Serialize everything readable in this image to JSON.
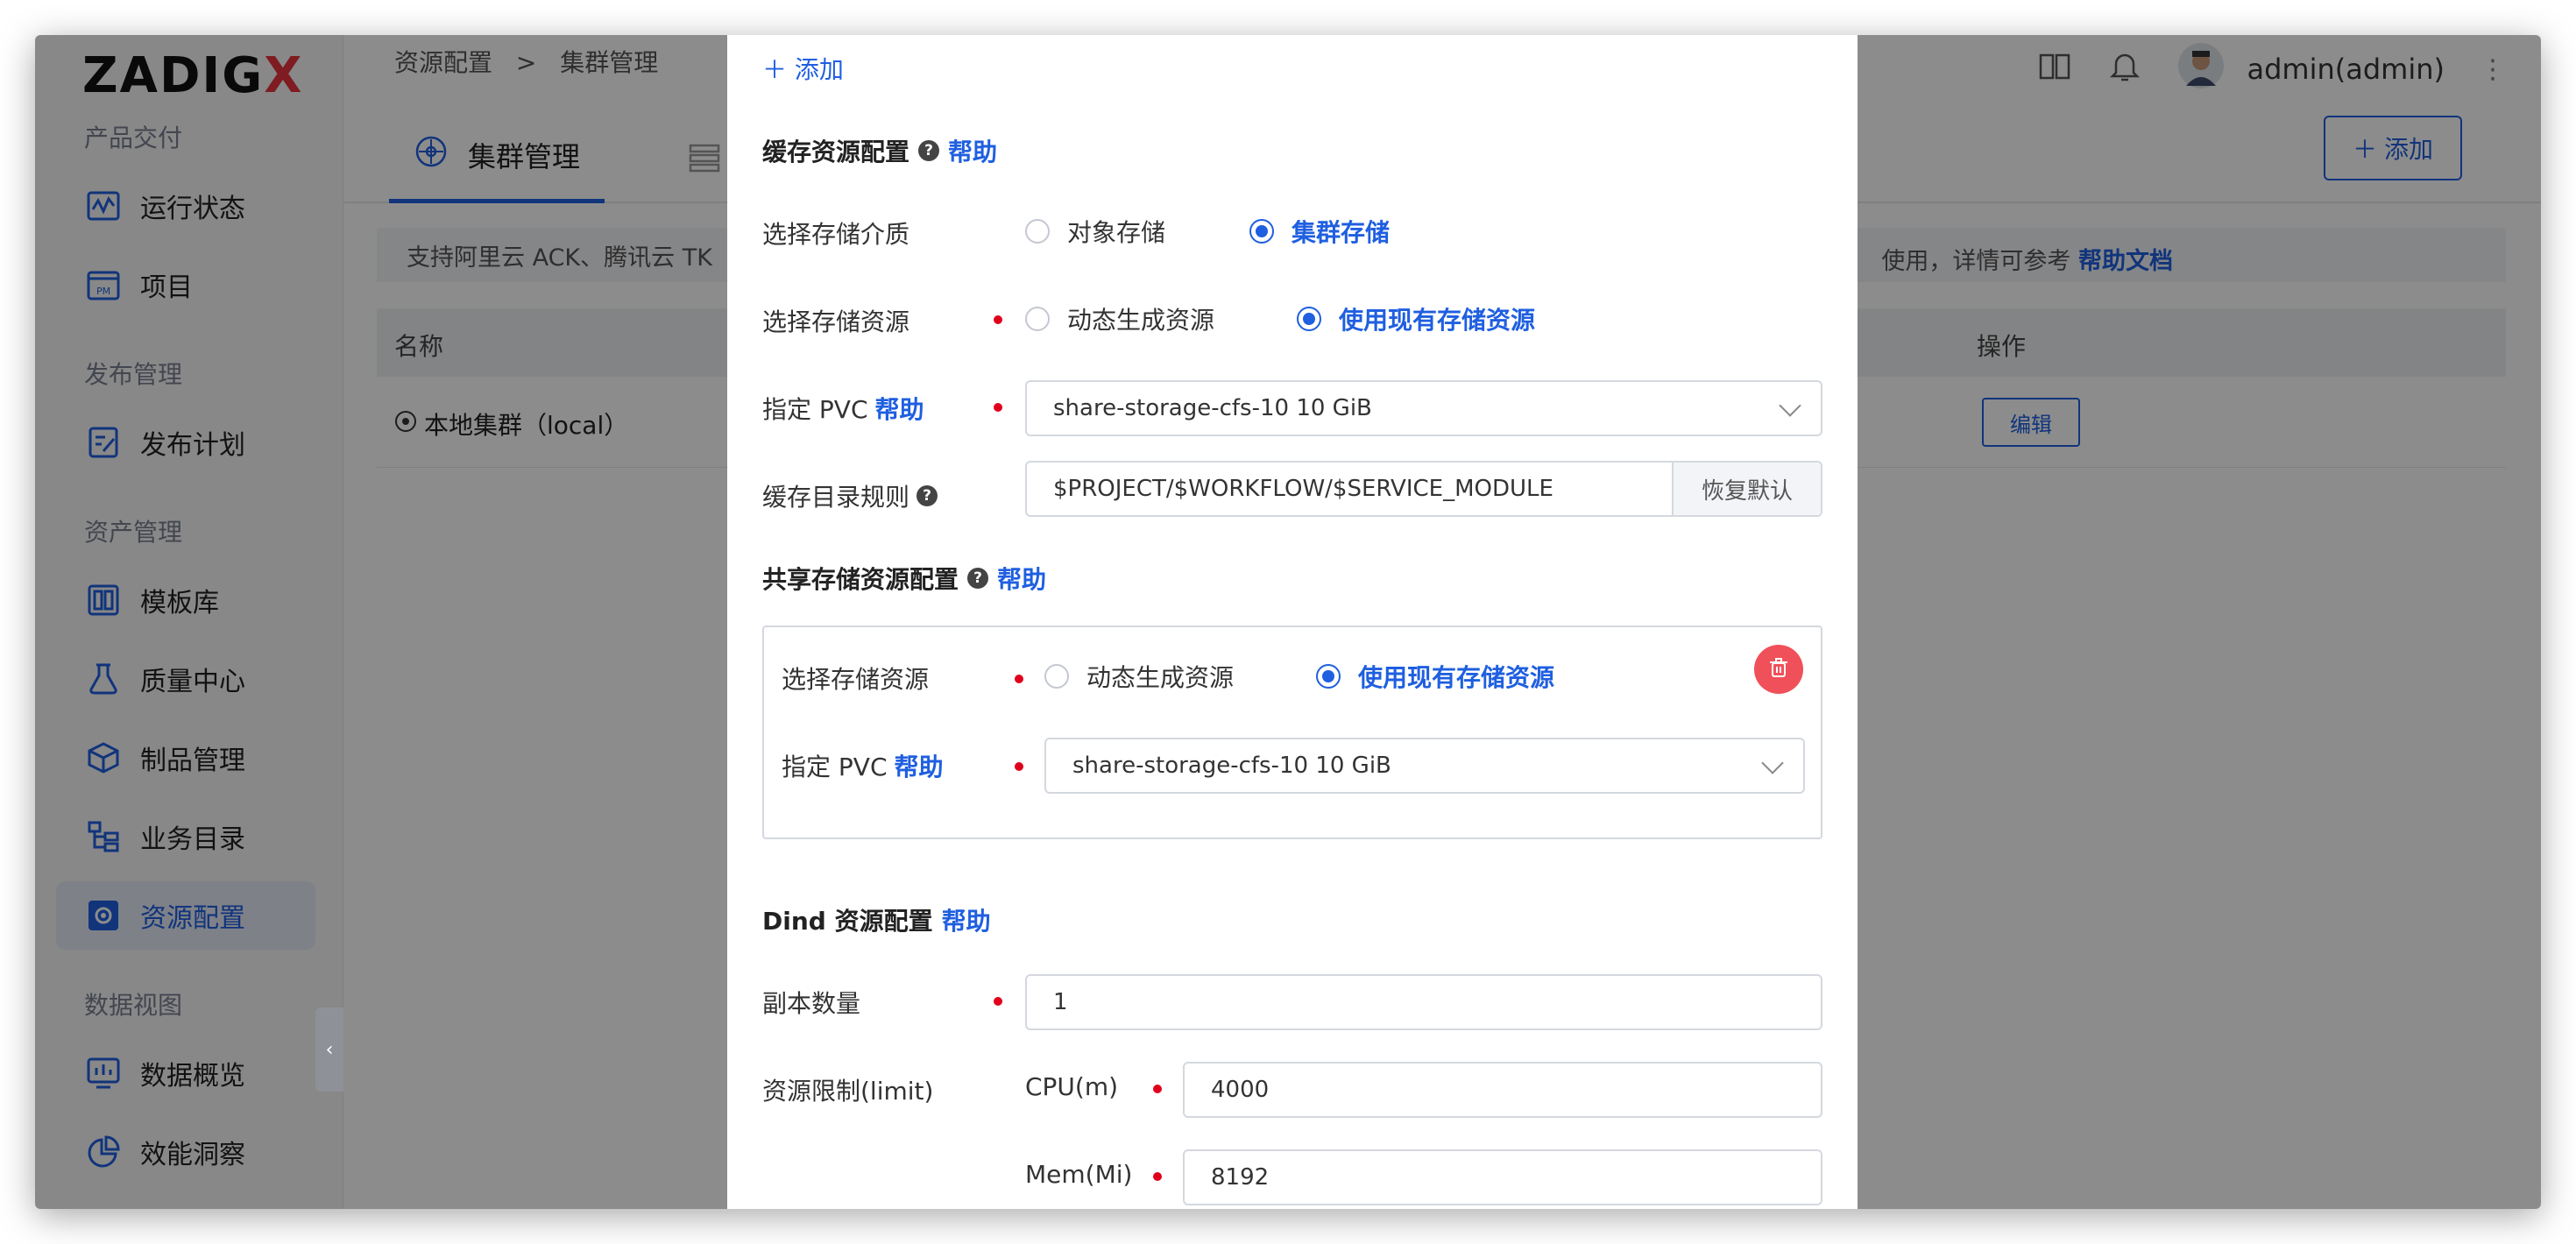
{
  "sidebar": {
    "logo_main": "ZADIG",
    "logo_x": "X",
    "sections": {
      "delivery": "产品交付",
      "release": "发布管理",
      "assets": "资产管理",
      "data": "数据视图"
    },
    "items": [
      {
        "label": "运行状态",
        "icon": "pulse-icon"
      },
      {
        "label": "项目",
        "icon": "pm-icon"
      },
      {
        "label": "发布计划",
        "icon": "plan-icon"
      },
      {
        "label": "模板库",
        "icon": "template-icon"
      },
      {
        "label": "质量中心",
        "icon": "flask-icon"
      },
      {
        "label": "制品管理",
        "icon": "package-icon"
      },
      {
        "label": "业务目录",
        "icon": "catalog-icon"
      },
      {
        "label": "资源配置",
        "icon": "gear-icon"
      },
      {
        "label": "数据概览",
        "icon": "chart-icon"
      },
      {
        "label": "效能洞察",
        "icon": "pie-icon"
      }
    ]
  },
  "header": {
    "breadcrumb_root": "资源配置",
    "breadcrumb_sep": ">",
    "breadcrumb_current": "集群管理",
    "user": "admin(admin)"
  },
  "tabs": {
    "cluster": "集群管理"
  },
  "toolbar": {
    "add_label": "添加"
  },
  "tip": {
    "left": "支持阿里云 ACK、腾讯云 TK",
    "right_prefix": "使用，详情可参考",
    "right_link": "帮助文档"
  },
  "table": {
    "col_name": "名称",
    "col_action": "操作",
    "row_name": "本地集群（local）",
    "row_action": "编辑"
  },
  "modal": {
    "add": "添加",
    "cache_title": "缓存资源配置",
    "help": "帮助",
    "storage_medium_label": "选择存储介质",
    "medium_option_object": "对象存储",
    "medium_option_cluster": "集群存储",
    "storage_resource_label": "选择存储资源",
    "resource_option_dynamic": "动态生成资源",
    "resource_option_existing": "使用现有存储资源",
    "pvc_label": "指定 PVC",
    "pvc_value": "share-storage-cfs-10 10 GiB",
    "cache_dir_label": "缓存目录规则",
    "cache_dir_value": "$PROJECT/$WORKFLOW/$SERVICE_MODULE",
    "restore_default": "恢复默认",
    "shared_title": "共享存储资源配置",
    "shared_storage_label": "选择存储资源",
    "shared_pvc_label": "指定 PVC",
    "shared_pvc_value": "share-storage-cfs-10 10 GiB",
    "dind_title": "Dind 资源配置",
    "replicas_label": "副本数量",
    "replicas_value": "1",
    "limit_label": "资源限制(limit)",
    "cpu_label": "CPU(m)",
    "cpu_value": "4000",
    "mem_label": "Mem(Mi)",
    "mem_value": "8192"
  },
  "colors": {
    "accent": "#1f5fe0",
    "required": "#e0001b",
    "danger": "#f0505a",
    "overlay": "rgba(0,0,0,0.45)"
  }
}
